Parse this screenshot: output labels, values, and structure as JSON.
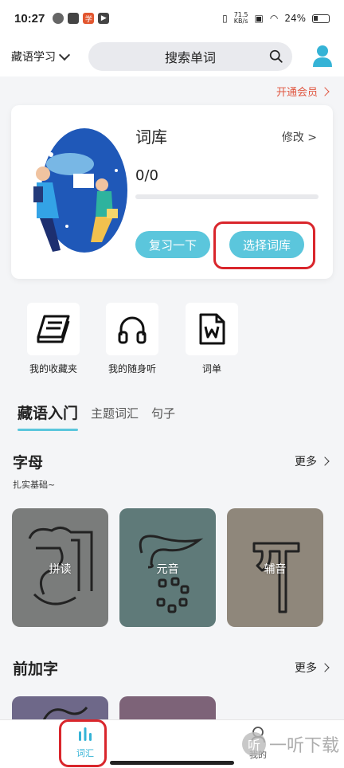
{
  "status_bar": {
    "time": "10:27",
    "net_speed": "71.5",
    "net_unit": "KB/s",
    "battery": "24%",
    "app_icon_glyph": "学"
  },
  "header": {
    "language": "藏语学习",
    "search_placeholder": "搜索单词"
  },
  "vip_link": "开通会员",
  "word_bank": {
    "title": "词库",
    "modify": "修改 >",
    "progress": "0/0",
    "progress_fraction": 0,
    "review_button": "复习一下",
    "choose_button": "选择词库"
  },
  "quick_actions": [
    {
      "label": "我的收藏夹",
      "icon": "book-icon"
    },
    {
      "label": "我的随身听",
      "icon": "headphones-icon"
    },
    {
      "label": "词单",
      "icon": "word-document-icon"
    }
  ],
  "tabs": [
    "藏语入门",
    "主题词汇",
    "句子"
  ],
  "sections": {
    "alphabet": {
      "title": "字母",
      "subtitle": "扎实基础~",
      "more": "更多",
      "tiles": [
        {
          "label": "拼读",
          "color": "#7a7c7b"
        },
        {
          "label": "元音",
          "color": "#5f7a79"
        },
        {
          "label": "辅音",
          "color": "#8f877b"
        }
      ]
    },
    "prefix": {
      "title": "前加字",
      "more": "更多",
      "tile_colors": [
        "#6e6889",
        "#7d6378"
      ]
    }
  },
  "bottom_nav": {
    "vocab": "词汇",
    "mine": "我的",
    "watermark": "一听下载",
    "watermark_badge": "听"
  },
  "colors": {
    "accent": "#5bc6dc",
    "highlight_box": "#d9262c",
    "vip": "#e0553f"
  }
}
